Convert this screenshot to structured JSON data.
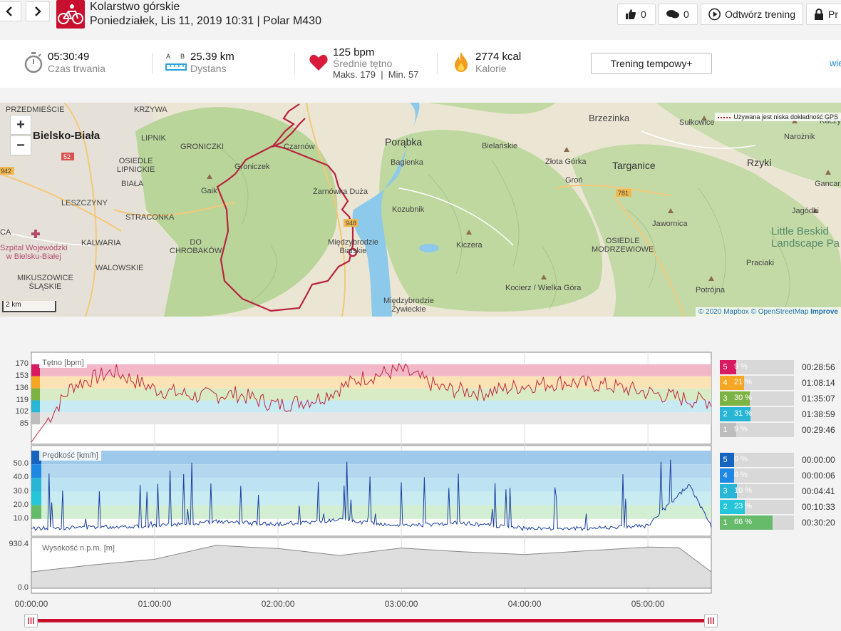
{
  "header": {
    "activity": "Kolarstwo górskie",
    "subtitle": "Poniedziałek, Lis 11, 2019 10:31 | Polar M430",
    "like_count": "0",
    "comment_count": "0",
    "replay_label": "Odtwórz trening",
    "more_label": "Pr",
    "colors": {
      "brand": "#c8102e"
    }
  },
  "summary": {
    "duration_value": "05:30:49",
    "duration_label": "Czas trwania",
    "distance_ab": "A B",
    "distance_value": "25.39 km",
    "distance_label": "Dystans",
    "hr_value": "125 bpm",
    "hr_label": "Średnie tętno",
    "hr_minmax": "Maks. 179  |  Min. 57",
    "kcal_value": "2774 kcal",
    "kcal_label": "Kalorie",
    "tempo_button": "Trening tempowy+",
    "more_link": "wie"
  },
  "map": {
    "labels": {
      "przedmiescie": "PRZEDMIEŚCIE",
      "krzywa": "KRZYWA",
      "bielsko": "Bielsko-Biała",
      "lipnik": "LIPNIK",
      "groniczki": "GRONICZKI",
      "czarnow": "Czarnów",
      "osiedle_lipnickie": "OSIEDLE\nLIPNICKIE",
      "biala": "BIAŁA",
      "leszczyny": "LESZCZYNY",
      "straconka": "STRACONKA",
      "kalwaria": "KALWARIA",
      "walowskie": "WALOWSKIE",
      "do_chrobakow": "DO\nCHROBAKÓW",
      "szpital": "Szpital Wojewódzki\nw Bielsku-Białej",
      "mikuszowice": "MIKUSZOWICE\nŚLĄSKIE",
      "zar": "Gaik",
      "groniczek": "Groniczek",
      "zarnowka": "Żarnówka Duża",
      "miedzybrodzie_b": "Międzybrodzie\nBialskie",
      "porabka": "Porąbka",
      "bagienka": "Bagienka",
      "kozubnik": "Kozubnik",
      "kiczera": "Kiczera",
      "bielanskie": "Bielańskie",
      "zlota_gorka": "Złota Górka",
      "gron": "Groń",
      "targanice": "Targanice",
      "brzezinka": "Brzezinka",
      "sulkowice": "Sułkowice",
      "rzyki": "Rzyki",
      "osiedle_modrz": "OSIEDLE\nMODRZEWIOWE",
      "jaworica": "Jawornica",
      "kocierz": "Kocierz / Wielka Góra",
      "miedzybrodzie_z": "Międzybrodzie\nŻywieckie",
      "praciaki": "Praciaki",
      "potrojna": "Potrójna",
      "jagodki": "Jagódki",
      "gancarz": "Gancarz",
      "narocznik": "Narożnik",
      "little_beskids": "Little Beskid\nLandscape Pa",
      "road_52": "52",
      "road_942": "942",
      "road_781": "781",
      "road_948": "948",
      "ca": "CA",
      "kaczy": "Kaczy"
    },
    "scale": "2 km",
    "gps_note": "Używana jest niska dokładność GPS",
    "attribution_1": "© 2020 Mapbox",
    "attribution_2": "© OpenStreetMap",
    "attribution_3": "Improve",
    "zoom_in": "+",
    "zoom_out": "−"
  },
  "charts": {
    "hr_title": "Tętno [bpm]",
    "speed_title": "Prędkość [km/h]",
    "alt_title": "Wysokość n.p.m. [m]",
    "hr_ticks": [
      "170",
      "153",
      "136",
      "119",
      "102",
      "85"
    ],
    "speed_ticks": [
      "50.0",
      "40.0",
      "30.0",
      "20.0",
      "10.0"
    ],
    "alt_ticks": [
      "930.4",
      "0.0"
    ],
    "x_ticks": [
      "00:00:00",
      "01:00:00",
      "02:00:00",
      "03:00:00",
      "04:00:00",
      "05:00:00"
    ]
  },
  "chart_data": [
    {
      "type": "line",
      "title": "Tętno [bpm]",
      "ylabel": "Tętno [bpm]",
      "x": [
        "00:00:00",
        "00:20:00",
        "00:40:00",
        "01:00:00",
        "01:20:00",
        "01:40:00",
        "02:00:00",
        "02:20:00",
        "02:40:00",
        "03:00:00",
        "03:20:00",
        "03:40:00",
        "04:00:00",
        "04:20:00",
        "04:40:00",
        "05:00:00",
        "05:20:00",
        "05:30:49"
      ],
      "series": [
        {
          "name": "Tętno",
          "values": [
            60,
            140,
            160,
            135,
            125,
            128,
            112,
            122,
            150,
            162,
            135,
            130,
            140,
            145,
            140,
            130,
            120,
            118
          ]
        }
      ],
      "ylim": [
        57,
        179
      ],
      "zones": [
        {
          "zone": "5",
          "percent": "9 %",
          "time": "00:28:56",
          "color": "#d81b60"
        },
        {
          "zone": "4",
          "percent": "21 %",
          "time": "01:08:14",
          "color": "#f5a623"
        },
        {
          "zone": "3",
          "percent": "30 %",
          "time": "01:35:07",
          "color": "#7cb342"
        },
        {
          "zone": "2",
          "percent": "31 %",
          "time": "01:38:59",
          "color": "#29b6d6"
        },
        {
          "zone": "1",
          "percent": "9 %",
          "time": "00:29:46",
          "color": "#bdbdbd"
        }
      ]
    },
    {
      "type": "line",
      "title": "Prędkość [km/h]",
      "ylabel": "Prędkość [km/h]",
      "x": [
        "00:00:00",
        "00:30:00",
        "01:00:00",
        "01:30:00",
        "02:00:00",
        "02:30:00",
        "03:00:00",
        "03:30:00",
        "04:00:00",
        "04:30:00",
        "05:00:00",
        "05:20:00",
        "05:30:49"
      ],
      "series": [
        {
          "name": "Prędkość",
          "values": [
            3,
            4,
            5,
            8,
            6,
            9,
            5,
            7,
            3,
            3,
            5,
            35,
            5
          ]
        }
      ],
      "ylim": [
        0,
        60
      ],
      "zones": [
        {
          "zone": "5",
          "percent": "0 %",
          "time": "00:00:00",
          "color": "#1565c0"
        },
        {
          "zone": "4",
          "percent": "0 %",
          "time": "00:00:06",
          "color": "#1e88e5"
        },
        {
          "zone": "3",
          "percent": "10 %",
          "time": "00:04:41",
          "color": "#29b6d6"
        },
        {
          "zone": "2",
          "percent": "23 %",
          "time": "00:10:33",
          "color": "#26c6da"
        },
        {
          "zone": "1",
          "percent": "66 %",
          "time": "00:30:20",
          "color": "#66bb6a"
        }
      ]
    },
    {
      "type": "area",
      "title": "Wysokość n.p.m. [m]",
      "ylabel": "Wysokość n.p.m. [m]",
      "x": [
        "00:00:00",
        "00:30:00",
        "01:00:00",
        "01:30:00",
        "01:45:00",
        "02:00:00",
        "02:30:00",
        "03:00:00",
        "03:30:00",
        "04:00:00",
        "04:30:00",
        "05:00:00",
        "05:15:00",
        "05:30:49"
      ],
      "series": [
        {
          "name": "Wysokość",
          "values": [
            350,
            500,
            620,
            920,
            880,
            850,
            700,
            860,
            780,
            720,
            800,
            880,
            870,
            350
          ]
        }
      ],
      "ylim": [
        0,
        930.4
      ]
    }
  ]
}
